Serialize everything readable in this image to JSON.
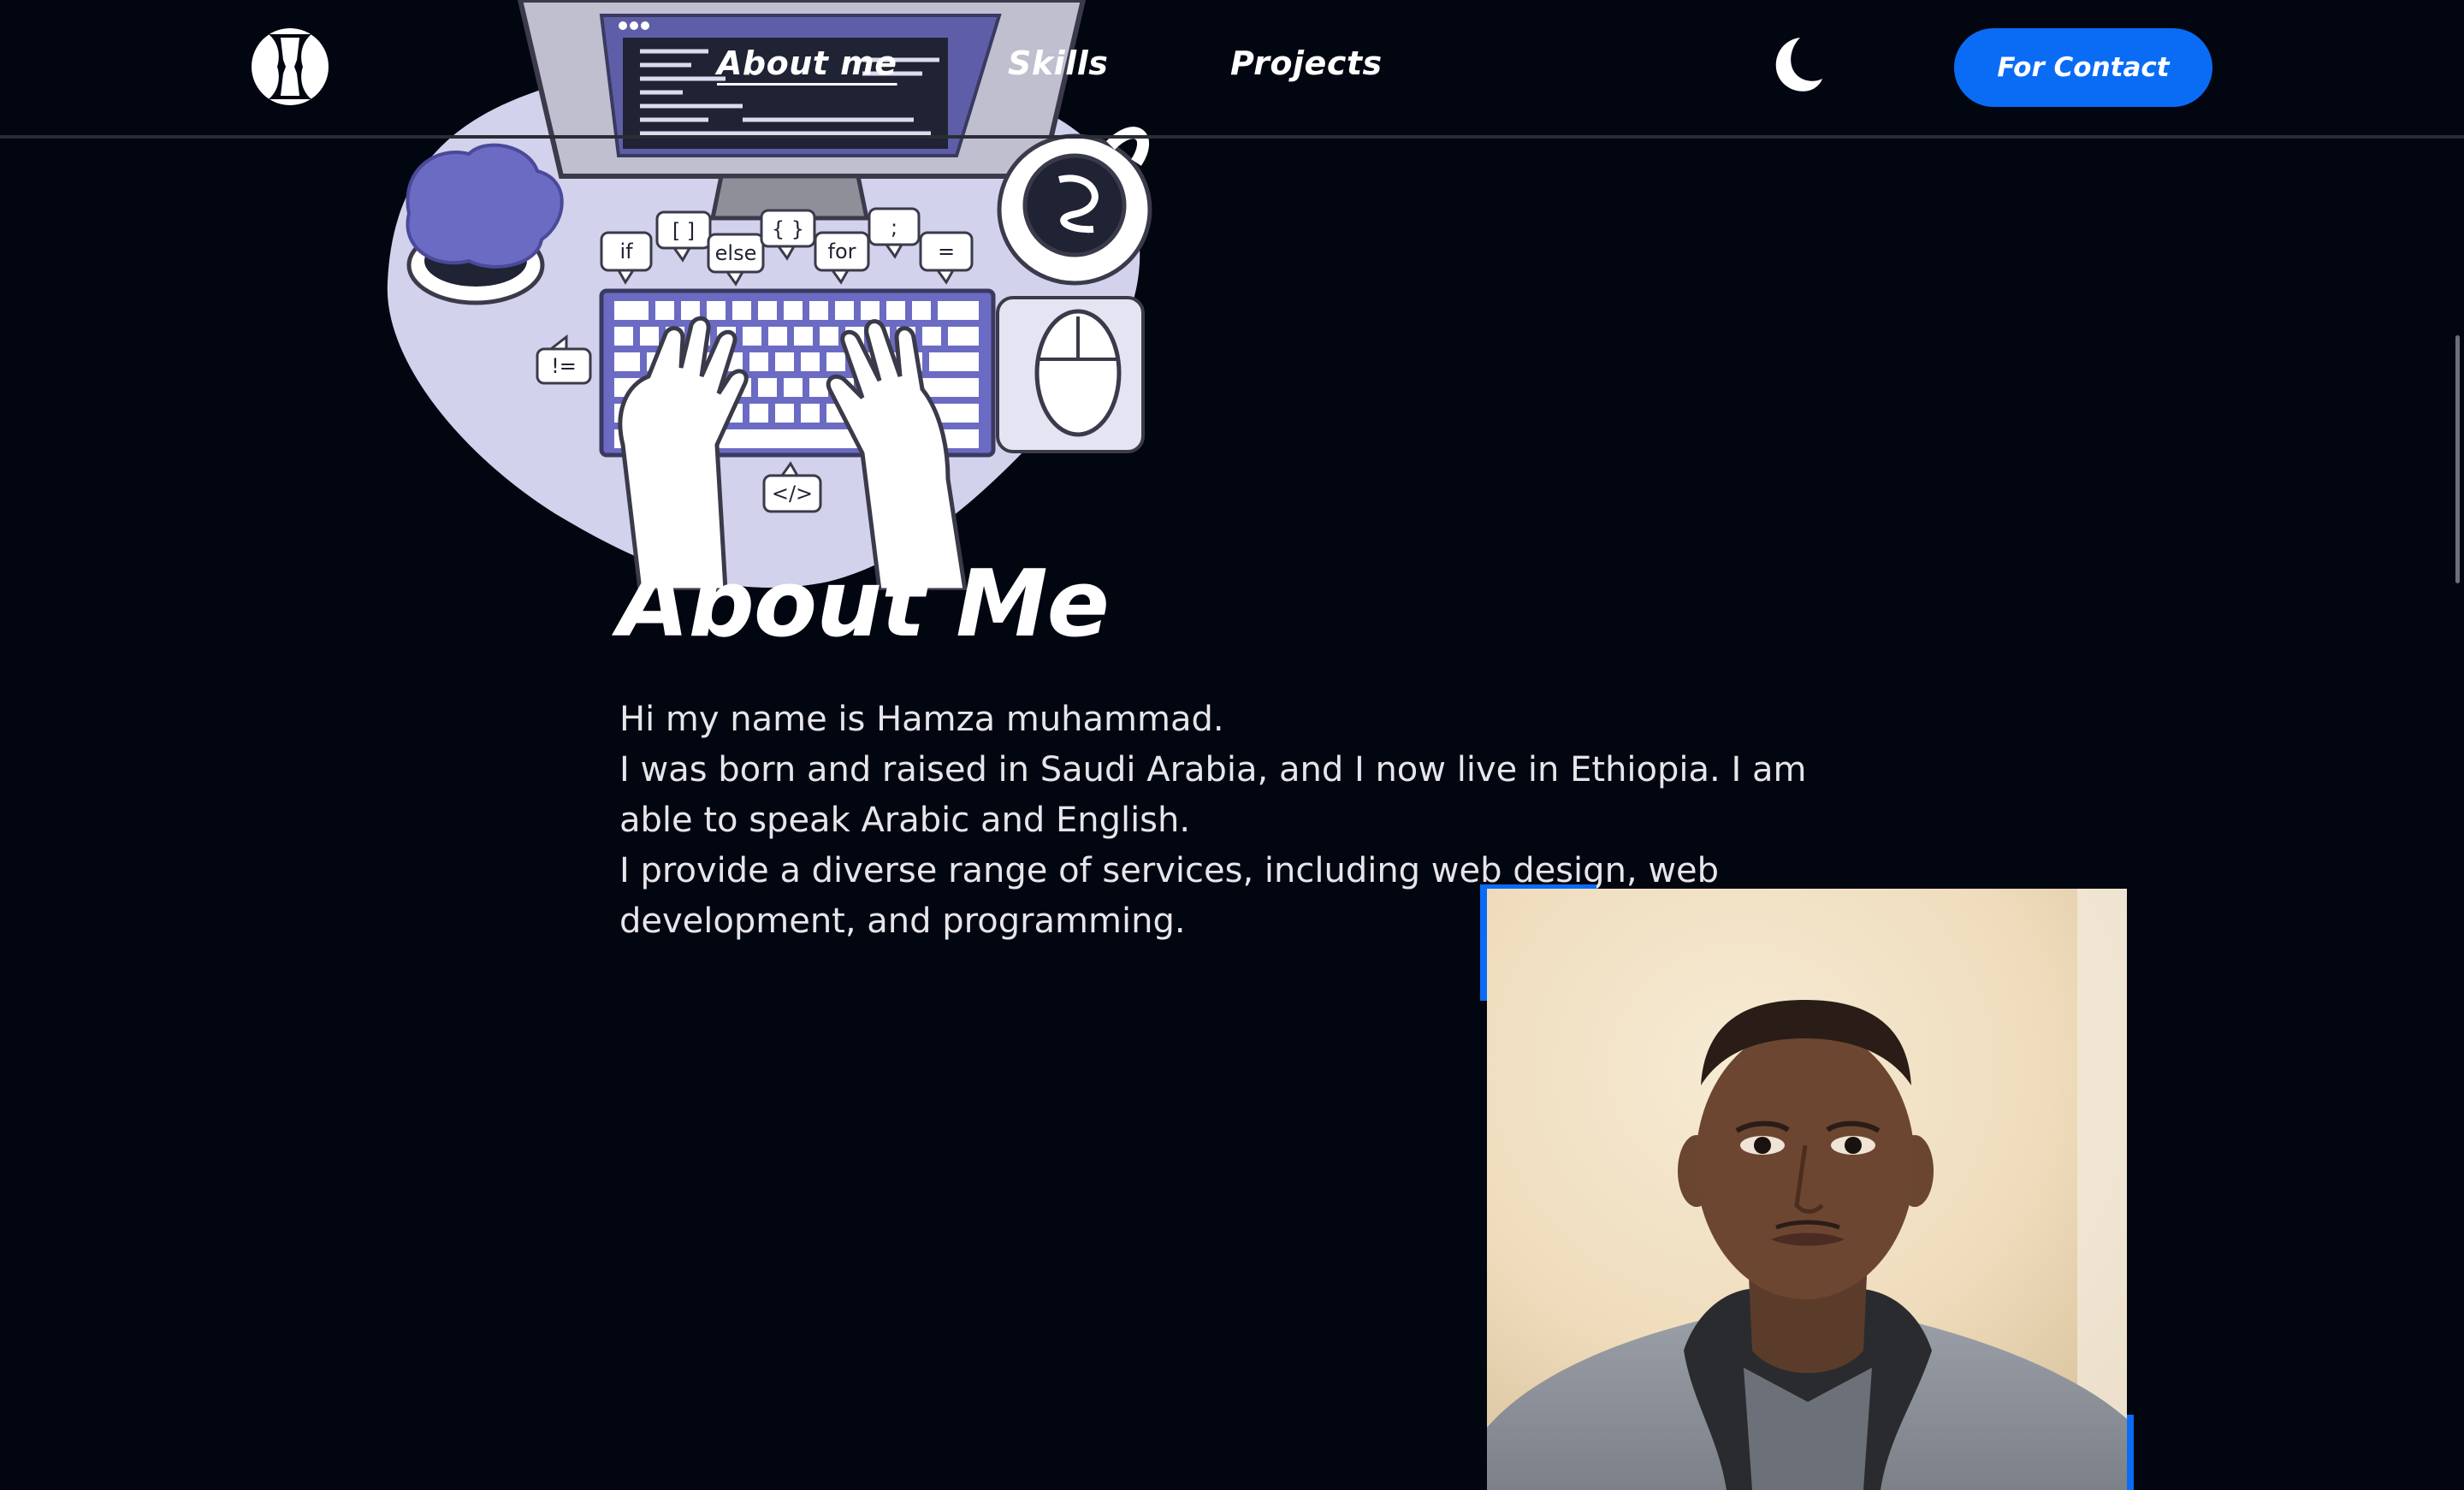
{
  "nav": {
    "logo_letter": "H",
    "links": [
      "About me",
      "Skills",
      "Projects"
    ],
    "contact_label": "For Contact"
  },
  "illustration": {
    "bubbles": [
      "if",
      "[ ]",
      "else",
      "{ }",
      "for",
      ";",
      "=",
      "!=",
      "</>"
    ]
  },
  "about": {
    "heading": "About Me",
    "paragraphs": [
      "Hi my name is Hamza muhammad.",
      "I was born and raised in Saudi Arabia, and I now live in Ethiopia. I am able to speak Arabic and English.",
      "I provide a diverse range of services, including web design, web development, and programming."
    ]
  },
  "colors": {
    "background": "#020611",
    "accent": "#0a6cf5",
    "illustration_blob": "#d2d2ec",
    "illustration_purple": "#6b6bc4"
  },
  "icons": {
    "theme_toggle": "moon-icon",
    "logo": "h-logo-icon"
  }
}
